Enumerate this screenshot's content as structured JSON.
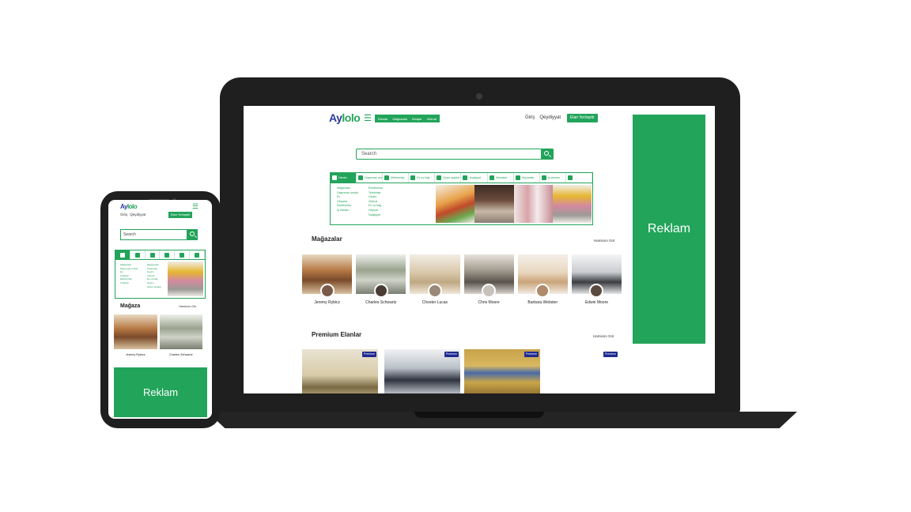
{
  "brand": {
    "logo_part1": "Ay",
    "logo_part2": "lolo"
  },
  "desktop": {
    "nav_links": [
      "Elanlar",
      "Mağazalar",
      "Bloqlar",
      "Xidmət"
    ],
    "auth": {
      "login": "Giriş",
      "register": "Qeydiyyat"
    },
    "cta_label": "Elan Yerləşdir",
    "search_placeholder": "Search",
    "categories": [
      {
        "label": "Hamisı",
        "icon": "grid-icon",
        "active": true
      },
      {
        "label": "Daşınmaz əmlak",
        "icon": "home-icon"
      },
      {
        "label": "Elektronika",
        "icon": "monitor-icon"
      },
      {
        "label": "Ev və bağ",
        "icon": "sofa-icon"
      },
      {
        "label": "Şəxsi əşyalar",
        "icon": "shirt-icon"
      },
      {
        "label": "Nəqliyyat",
        "icon": "car-icon"
      },
      {
        "label": "Xidmətlər",
        "icon": "tools-icon"
      },
      {
        "label": "Heyvanlar",
        "icon": "pet-icon"
      },
      {
        "label": "İş elanları",
        "icon": "briefcase-icon"
      },
      {
        "label": "→",
        "icon": "arrow-icon"
      }
    ],
    "subcategories_col1": [
      "Mağazalar",
      "Daşınmaz əmlak",
      "Ev",
      "Cihazlar",
      "Elektronika",
      "İş elanları"
    ],
    "subcategories_col2": [
      "Elektronika",
      "Telefonlar",
      "Geyim",
      "Xidmət",
      "Ev və bağ",
      "Heyvan",
      "Nəqliyyat"
    ],
    "store_section": {
      "title": "Mağazalar",
      "see_all": "Hamisını Gör"
    },
    "stores": [
      "Jeremy Rybicz",
      "Charles Schwartz",
      "Chester Lucas",
      "Chris Moore",
      "Barbara Webster",
      "Edwin Moore"
    ],
    "premium_section": {
      "title": "Premium Elanlar",
      "see_all": "Hamisını Gör"
    },
    "premium_badge": "Premium",
    "ad_label": "Reklam"
  },
  "mobile": {
    "auth": {
      "login": "Giriş",
      "register": "Qeydiyyat"
    },
    "cta_label": "Elan Yerləşdir",
    "search_placeholder": "Search",
    "subcategories_col1": [
      "Mağazalar",
      "Daşınmaz əmlak",
      "Ev",
      "Cihazlar",
      "Elektronika",
      "Cihazlar"
    ],
    "subcategories_col2": [
      "Elektronika",
      "Telefonlar",
      "Geyim",
      "Xidmət",
      "Ev və bağ",
      "Geyim",
      "Şəxsi əşyalar"
    ],
    "store_section": {
      "title": "Mağaza",
      "see_all": "Hamisını Gör"
    },
    "stores": [
      "Jeremy Rybicz",
      "Charles Schwartz"
    ],
    "ad_label": "Reklam"
  },
  "colors": {
    "accent": "#22a45a",
    "brand_blue": "#2a3aa0",
    "badge": "#1f2a8f",
    "device": "#1f1f1f"
  }
}
